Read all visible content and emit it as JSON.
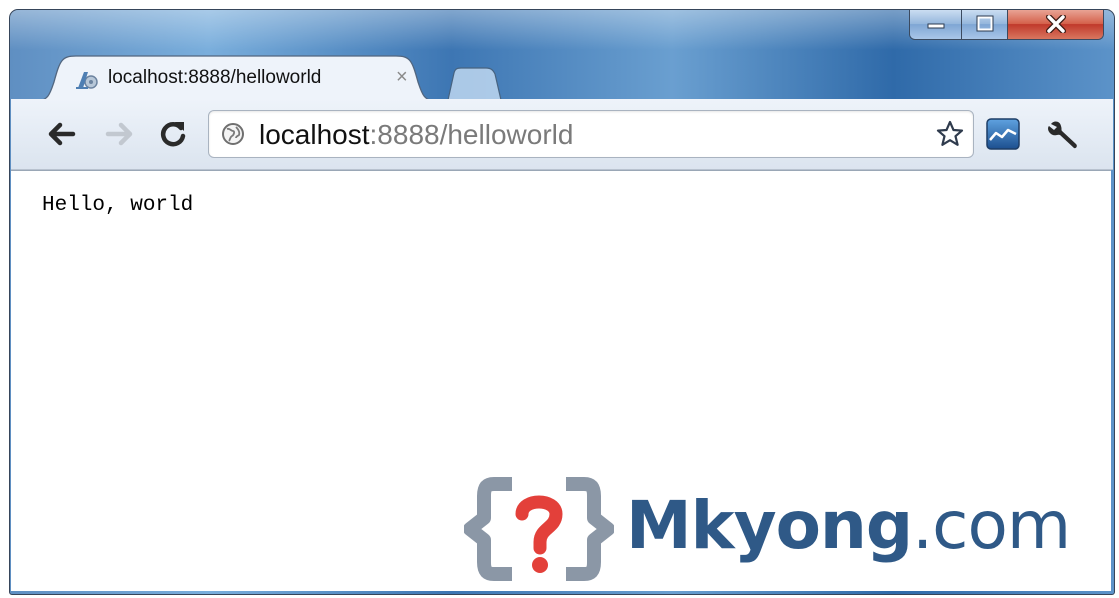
{
  "tab": {
    "title": "localhost:8888/helloworld",
    "close_glyph": "×"
  },
  "caption": {
    "minimize": "minimize-icon",
    "maximize": "maximize-icon",
    "close": "close-icon"
  },
  "toolbar": {
    "back": "back-arrow-icon",
    "forward": "forward-arrow-icon",
    "reload": "reload-icon",
    "menu": "wrench-icon"
  },
  "omnibox": {
    "host": "localhost",
    "rest": ":8888/helloworld",
    "bookmark": "star-icon"
  },
  "page": {
    "body_text": "Hello, world"
  },
  "watermark": {
    "text": "Mkyong",
    "tld": ".com",
    "mark_glyph": "?",
    "color": "#2f5987",
    "mark_color": "#e3403a"
  }
}
